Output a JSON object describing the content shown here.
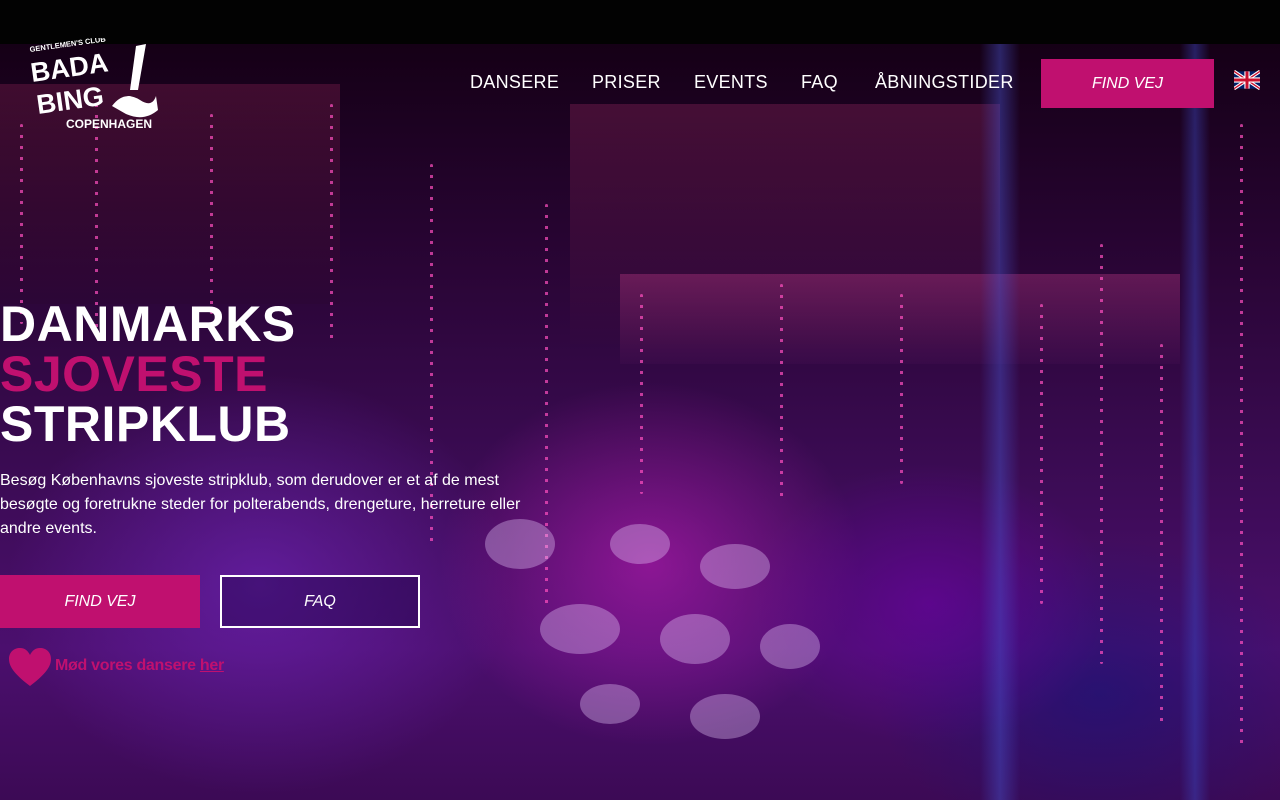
{
  "brand": {
    "logo_top": "GENTLEMEN'S CLUB",
    "logo_main_1": "BADA",
    "logo_main_2": "BING",
    "logo_bottom": "COPENHAGEN"
  },
  "nav": {
    "items": [
      "DANSERE",
      "PRISER",
      "EVENTS",
      "FAQ",
      "ÅBNINGSTIDER"
    ],
    "cta": "FIND VEJ",
    "language_icon": "uk-flag-icon"
  },
  "hero": {
    "line1": "DANMARKS",
    "line2": "SJOVESTE",
    "line3": "STRIPKLUB",
    "description": "Besøg Københavns sjoveste stripklub, som derudover er et af de mest besøgte og foretrukne steder for polterabends, drengeture, herreture eller andre events.",
    "primary_button": "FIND VEJ",
    "secondary_button": "FAQ",
    "meet_text": "Mød vores dansere",
    "meet_link": "her"
  },
  "colors": {
    "accent": "#c0106f",
    "background": "#2a0536"
  }
}
